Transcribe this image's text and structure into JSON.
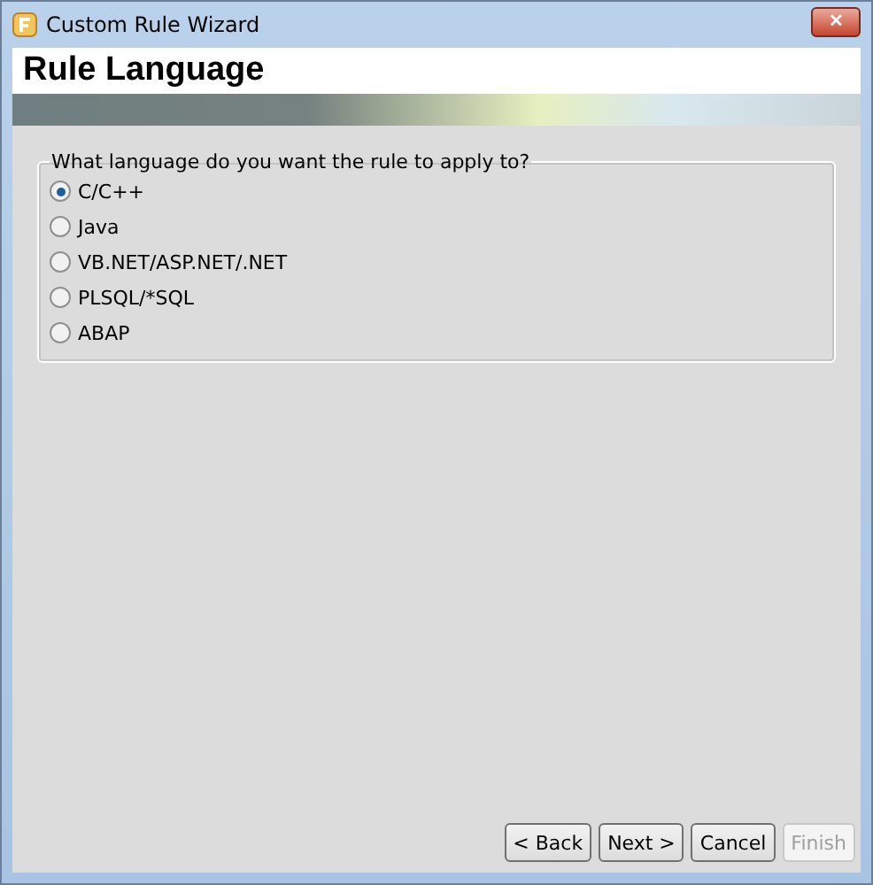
{
  "window": {
    "title": "Custom Rule Wizard",
    "close": "✕"
  },
  "header": {
    "title": "Rule Language"
  },
  "group": {
    "label": "What language do you want the rule to apply to?",
    "options": [
      {
        "label": "C/C++",
        "selected": true
      },
      {
        "label": "Java",
        "selected": false
      },
      {
        "label": "VB.NET/ASP.NET/.NET",
        "selected": false
      },
      {
        "label": "PLSQL/*SQL",
        "selected": false
      },
      {
        "label": "ABAP",
        "selected": false
      }
    ]
  },
  "buttons": [
    {
      "label": "< Back",
      "disabled": false
    },
    {
      "label": "Next >",
      "disabled": false
    },
    {
      "label": "Cancel",
      "disabled": false
    },
    {
      "label": "Finish",
      "disabled": true
    }
  ]
}
